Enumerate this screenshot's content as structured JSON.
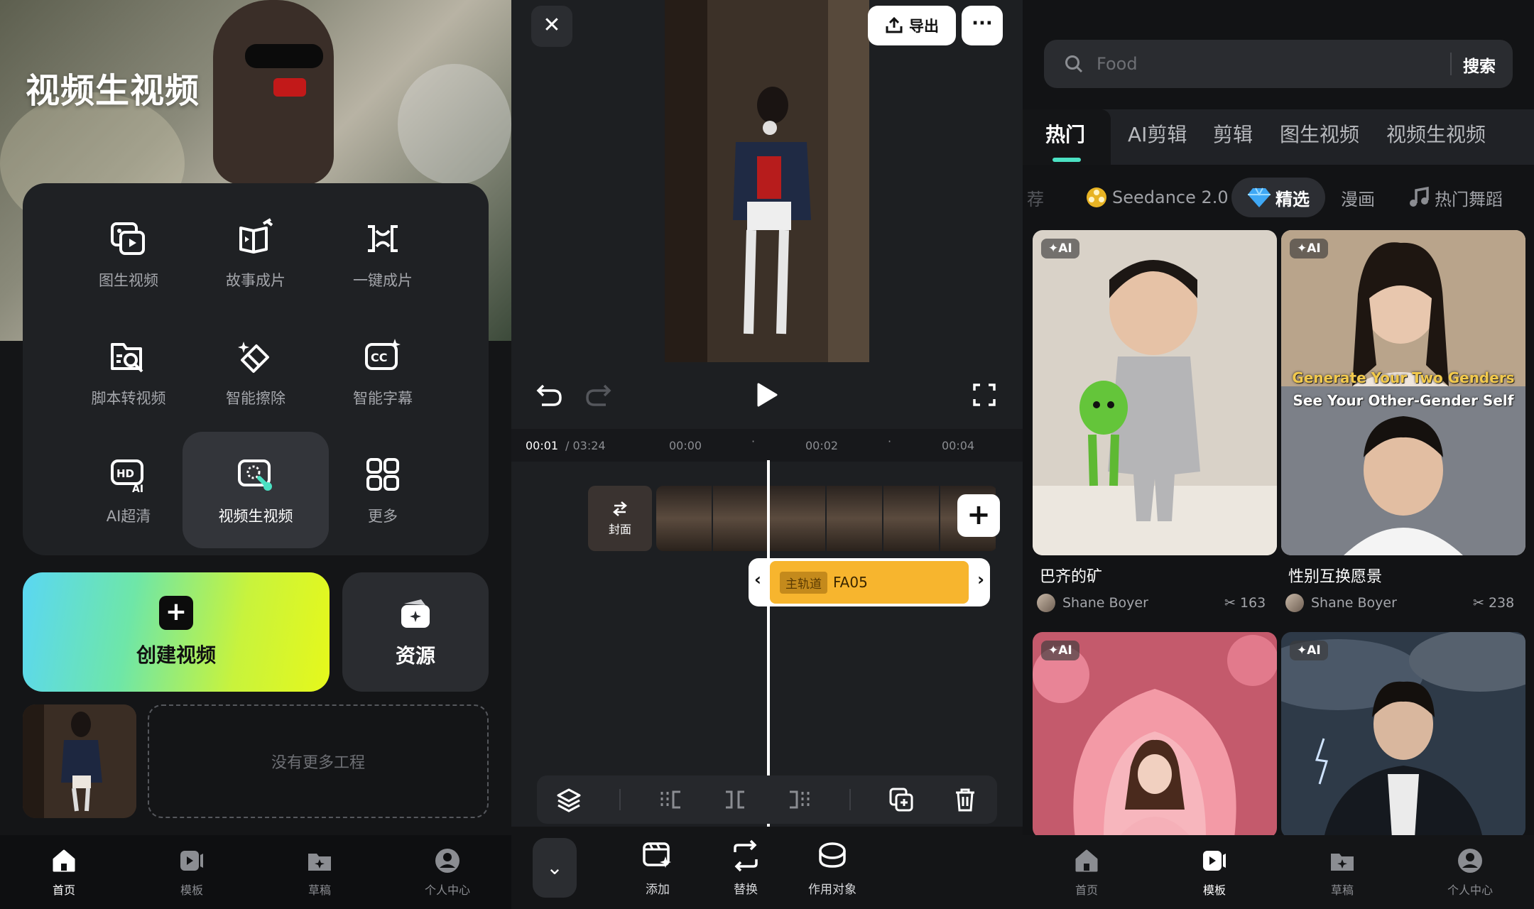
{
  "home": {
    "hero_title": "视频生视频",
    "tools": [
      {
        "label": "图生视频",
        "icon": "image-to-video-icon"
      },
      {
        "label": "故事成片",
        "icon": "story-icon"
      },
      {
        "label": "一键成片",
        "icon": "one-click-icon"
      },
      {
        "label": "脚本转视频",
        "icon": "script-icon"
      },
      {
        "label": "智能擦除",
        "icon": "eraser-icon"
      },
      {
        "label": "智能字幕",
        "icon": "subtitle-icon"
      },
      {
        "label": "AI超清",
        "icon": "hd-icon"
      },
      {
        "label": "视频生视频",
        "icon": "video-to-video-icon",
        "selected": true
      },
      {
        "label": "更多",
        "icon": "grid-icon"
      }
    ],
    "create_label": "创建视频",
    "resource_label": "资源",
    "empty_projects": "没有更多工程"
  },
  "nav": {
    "items": [
      {
        "label": "首页",
        "icon": "home-icon"
      },
      {
        "label": "模板",
        "icon": "template-icon"
      },
      {
        "label": "草稿",
        "icon": "draft-icon"
      },
      {
        "label": "个人中心",
        "icon": "profile-icon"
      }
    ],
    "panel1_active": 0,
    "panel3_active": 1
  },
  "editor": {
    "export_label": "导出",
    "time_current": "00:01",
    "time_total": "/ 03:24",
    "ticks": [
      "00:00",
      "00:02",
      "00:04"
    ],
    "cover_label": "封面",
    "audio_tag": "主轨道",
    "audio_name": "FA05",
    "bottom_tools": [
      {
        "label": "添加",
        "icon": "add-clip-icon"
      },
      {
        "label": "替换",
        "icon": "replace-icon"
      },
      {
        "label": "作用对象",
        "icon": "target-icon"
      }
    ]
  },
  "templates": {
    "search_placeholder": "Food",
    "search_button": "搜索",
    "tabs": [
      "热门",
      "AI剪辑",
      "剪辑",
      "图生视频",
      "视频生视频"
    ],
    "chips": [
      "荐",
      "Seedance 2.0",
      "精选",
      "漫画",
      "热门舞蹈"
    ],
    "ai_tag": "✦AI",
    "cards": [
      {
        "title": "巴齐的矿",
        "author": "Shane Boyer",
        "count": "163"
      },
      {
        "title": "性别互换愿景",
        "author": "Shane Boyer",
        "count": "238",
        "overlay1": "Generate Your Two Genders",
        "overlay2": "See Your Other-Gender Self"
      }
    ]
  },
  "colors": {
    "accent": "#4be1c3",
    "audio": "#f7b52e",
    "create_gradient_start": "#5ad7f3",
    "create_gradient_end": "#e6f81b"
  }
}
